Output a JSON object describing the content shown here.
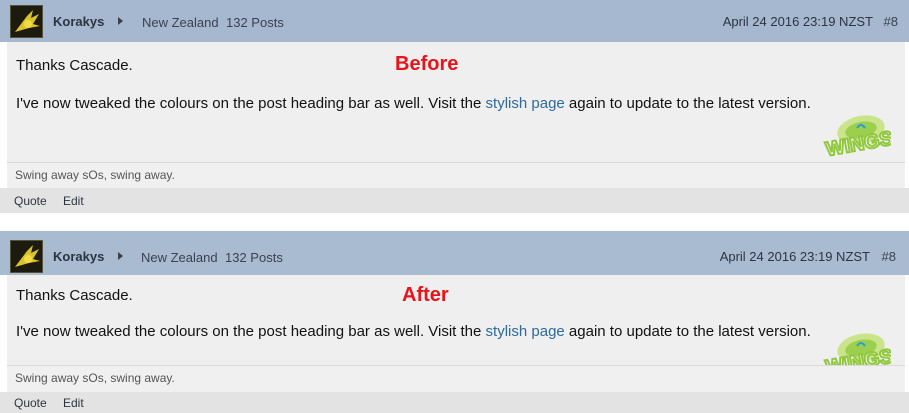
{
  "posts": [
    {
      "label": "Before",
      "username": "Korakys",
      "location": "New Zealand",
      "post_count": "132 Posts",
      "date": "April 24 2016 23:19 NZST",
      "post_number": "#8",
      "line1": "Thanks Cascade.",
      "line2_before": "I've now tweaked the colours on the post heading bar as well. Visit the ",
      "link_text": "stylish page",
      "line2_after": " again to update to the latest version.",
      "signature": "Swing away sOs, swing away.",
      "actions": {
        "quote": "Quote",
        "edit": "Edit"
      }
    },
    {
      "label": "After",
      "username": "Korakys",
      "location": "New Zealand",
      "post_count": "132 Posts",
      "date": "April 24 2016 23:19 NZST",
      "post_number": "#8",
      "line1": "Thanks Cascade.",
      "line2_before": "I've now tweaked the colours on the post heading bar as well. Visit the ",
      "link_text": "stylish page",
      "line2_after": " again to update to the latest version.",
      "signature": "Swing away sOs, swing away.",
      "actions": {
        "quote": "Quote",
        "edit": "Edit"
      }
    }
  ],
  "watermark": "WINGS",
  "colors": {
    "label_red": "#e8141a",
    "header_blue": "#a6b8cf",
    "link": "#2d6a9e"
  },
  "icons": {
    "avatar": "winged-emblem-icon",
    "expand": "arrow-right-icon",
    "watermark": "wings-logo"
  }
}
